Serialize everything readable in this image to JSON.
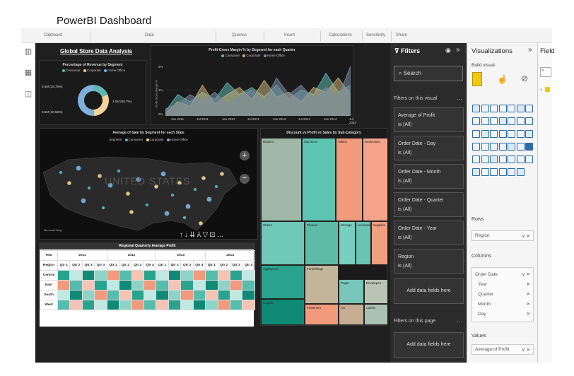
{
  "page_title": "PowerBI Dashboard",
  "ribbon": [
    "Clipboard",
    "Data",
    "Queries",
    "Insert",
    "Calculations",
    "Sensitivity",
    "Share"
  ],
  "dashboard": {
    "title": "Global Store Data Analysis",
    "donut": {
      "title": "Percentage of Revenue by Segment",
      "legend": [
        "Consumer",
        "Corporate",
        "Home Office"
      ],
      "labels": [
        "0.4M (18.75%)",
        "0.6M (30.56%)",
        "1.1M (50.7%)"
      ],
      "values": [
        18.75,
        30.56,
        50.7
      ],
      "colors": [
        "#5fb8b0",
        "#f0d49a",
        "#7eb0dc"
      ]
    },
    "area": {
      "title": "Profit Gross Margin % by Segment for each Quarter",
      "legend": [
        "Consumer",
        "Corporate",
        "Home Office"
      ],
      "yticks": [
        "2%",
        "1%",
        "0%"
      ],
      "ylabel": "Profit Gross Margin %",
      "xticks": [
        "Jan 2011",
        "Jul 2011",
        "Jan 2012",
        "Jul 2012",
        "Jan 2013",
        "Jul 2013",
        "Jan 2014",
        "Jul 2014"
      ],
      "series": [
        {
          "name": "Consumer",
          "color": "#5fb8b0",
          "values": [
            0.2,
            0.9,
            0.6,
            1.0,
            0.7,
            1.4,
            0.9,
            1.2,
            0.8,
            1.3,
            0.7,
            1.1,
            0.9,
            1.8,
            1.0,
            1.3
          ]
        },
        {
          "name": "Corporate",
          "color": "#c8b07a",
          "values": [
            0.1,
            0.6,
            0.4,
            1.3,
            0.5,
            0.9,
            1.2,
            0.7,
            1.5,
            0.8,
            1.0,
            0.6,
            1.2,
            1.0,
            1.6,
            0.9
          ]
        },
        {
          "name": "Home Office",
          "color": "#7c8ca6",
          "values": [
            0.3,
            0.5,
            0.9,
            0.6,
            1.0,
            0.5,
            0.8,
            1.1,
            0.6,
            1.6,
            0.9,
            1.3,
            0.7,
            1.2,
            0.8,
            2.1
          ]
        }
      ]
    },
    "map": {
      "title": "Average of Sale by Segment for each State",
      "legend_label": "Segment",
      "legend": [
        "Consumer",
        "Corporate",
        "Home Office"
      ],
      "country_label": "UNITED STATES",
      "attribution": "Microsoft Bing"
    },
    "treemap": {
      "title": "Discount vs Profit vs Sales by Sub-Category",
      "cells": [
        "Binders",
        "Machines",
        "Tables",
        "Bookcases",
        "Chairs",
        "Phones",
        "Storage",
        "Accessories",
        "Supplies",
        "Appliances",
        "Furnishings",
        "Paper",
        "Copiers",
        "Art",
        "Labels",
        "Fasteners",
        "Envelopes"
      ]
    },
    "matrix": {
      "title": "Regional Quarterly Average Profit",
      "col_header": "Year",
      "row_header": "Region",
      "years": [
        "2011",
        "2012",
        "2013",
        "2014"
      ],
      "quarters": [
        "Qtr 1",
        "Qtr 2",
        "Qtr 3",
        "Qtr 4"
      ],
      "regions": [
        "Central",
        "East",
        "South",
        "West"
      ]
    }
  },
  "filters": {
    "title": "Filters",
    "search_placeholder": "Search",
    "on_visual_label": "Filters on this visual",
    "cards": [
      {
        "name": "Average of Profit",
        "value": "is (All)"
      },
      {
        "name": "Order Date - Day",
        "value": "is (All)"
      },
      {
        "name": "Order Date - Month",
        "value": "is (All)"
      },
      {
        "name": "Order Date - Quarter",
        "value": "is (All)"
      },
      {
        "name": "Order Date - Year",
        "value": "is (All)"
      },
      {
        "name": "Region",
        "value": "is (All)"
      }
    ],
    "add_fields": "Add data fields here",
    "on_page_label": "Filters on this page",
    "add_fields_page": "Add data fields here"
  },
  "visualizations": {
    "title": "Visualizations",
    "build_visual": "Build visual",
    "rows_label": "Rows",
    "rows_field": "Region",
    "columns_label": "Columns",
    "columns_field": "Order Date",
    "columns_subfields": [
      "Year",
      "Quarter",
      "Month",
      "Day"
    ],
    "values_label": "Values",
    "values_field": "Average of Profit"
  },
  "fields_strip_title": "Field",
  "colors": {
    "accent": "#f2c811",
    "filter_bg": "#2b2b2b",
    "canvas_bg": "#202020"
  }
}
